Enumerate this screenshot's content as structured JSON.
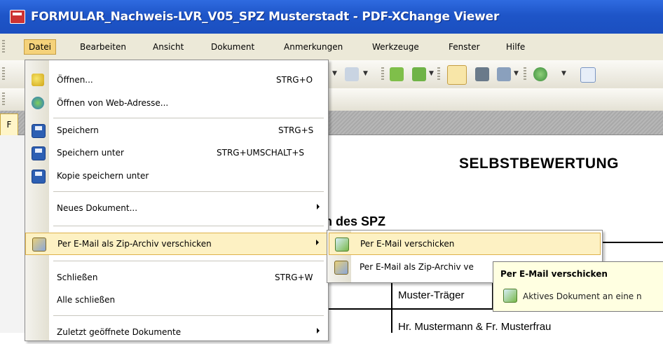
{
  "window": {
    "title": "FORMULAR_Nachweis-LVR_V05_SPZ Musterstadt - PDF-XChange Viewer"
  },
  "menubar": {
    "items": [
      "Datei",
      "Bearbeiten",
      "Ansicht",
      "Dokument",
      "Anmerkungen",
      "Werkzeuge",
      "Fenster",
      "Hilfe"
    ]
  },
  "tabs": {
    "active_partial": "F"
  },
  "file_menu": {
    "items": [
      {
        "label": "Öffnen...",
        "shortcut": "STRG+O",
        "icon": "open-folder-icon"
      },
      {
        "label": "Öffnen von Web-Adresse...",
        "shortcut": "",
        "icon": "globe-icon"
      },
      {
        "label": "Speichern",
        "shortcut": "STRG+S",
        "icon": "save-disk-icon"
      },
      {
        "label": "Speichern unter",
        "shortcut": "STRG+UMSCHALT+S",
        "icon": "save-as-icon"
      },
      {
        "label": "Kopie speichern unter",
        "shortcut": "",
        "icon": "save-copy-icon"
      },
      {
        "label": "Neues Dokument...",
        "shortcut": "",
        "submenu": true
      },
      {
        "label": "Per E-Mail als Zip-Archiv verschicken",
        "shortcut": "",
        "submenu": true,
        "highlighted": true,
        "icon": "zip-mail-icon"
      },
      {
        "label": "Schließen",
        "shortcut": "STRG+W"
      },
      {
        "label": "Alle schließen",
        "shortcut": ""
      },
      {
        "label": "Zuletzt geöffnete Dokumente",
        "shortcut": "",
        "submenu": true
      }
    ]
  },
  "email_submenu": {
    "items": [
      {
        "label": "Per E-Mail verschicken",
        "highlighted": true,
        "icon": "email-icon"
      },
      {
        "label": "Per E-Mail als Zip-Archiv ve",
        "highlighted": false,
        "icon": "zip-mail-icon"
      }
    ]
  },
  "tooltip": {
    "title": "Per E-Mail verschicken",
    "description": "Aktives Dokument an eine n"
  },
  "document": {
    "title": "SELBSTBEWERTUNG",
    "heading_partial": "n des SPZ",
    "cell_traeger": "Muster-Träger",
    "cell_leitung": "Hr. Mustermann & Fr. Musterfrau"
  }
}
